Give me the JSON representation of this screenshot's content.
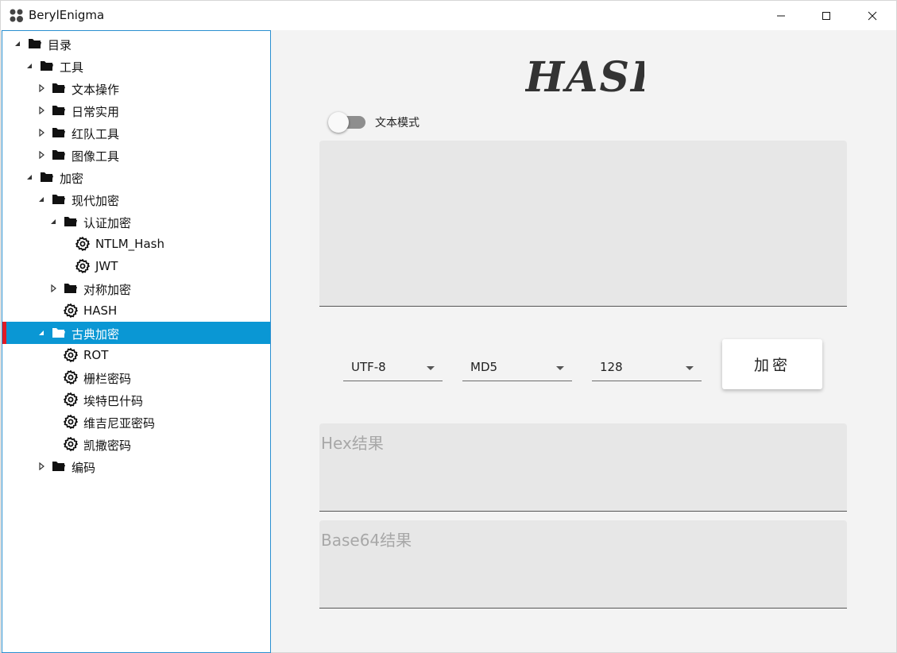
{
  "window": {
    "title": "BerylEnigma"
  },
  "tree": [
    {
      "label": "目录",
      "icon": "folder-icon",
      "arrow": "expanded",
      "level": 0
    },
    {
      "label": "工具",
      "icon": "folder-icon",
      "arrow": "expanded",
      "level": 1
    },
    {
      "label": "文本操作",
      "icon": "folder-icon",
      "arrow": "collapsed",
      "level": 2
    },
    {
      "label": "日常实用",
      "icon": "folder-icon",
      "arrow": "collapsed",
      "level": 2
    },
    {
      "label": "红队工具",
      "icon": "folder-icon",
      "arrow": "collapsed",
      "level": 2
    },
    {
      "label": "图像工具",
      "icon": "folder-icon",
      "arrow": "collapsed",
      "level": 2
    },
    {
      "label": "加密",
      "icon": "folder-icon",
      "arrow": "expanded",
      "level": 1
    },
    {
      "label": "现代加密",
      "icon": "folder-icon",
      "arrow": "expanded",
      "level": 2
    },
    {
      "label": "认证加密",
      "icon": "folder-icon",
      "arrow": "expanded",
      "level": 3
    },
    {
      "label": "NTLM_Hash",
      "icon": "gear-icon",
      "arrow": "none",
      "level": 4
    },
    {
      "label": "JWT",
      "icon": "gear-icon",
      "arrow": "none",
      "level": 4
    },
    {
      "label": "对称加密",
      "icon": "folder-icon",
      "arrow": "collapsed",
      "level": 3
    },
    {
      "label": "HASH",
      "icon": "gear-icon",
      "arrow": "none",
      "level": 3
    },
    {
      "label": "古典加密",
      "icon": "folder-icon",
      "arrow": "expanded",
      "level": 2,
      "selected": true
    },
    {
      "label": "ROT",
      "icon": "gear-icon",
      "arrow": "none",
      "level": 3
    },
    {
      "label": "栅栏密码",
      "icon": "gear-icon",
      "arrow": "none",
      "level": 3
    },
    {
      "label": "埃特巴什码",
      "icon": "gear-icon",
      "arrow": "none",
      "level": 3
    },
    {
      "label": "维吉尼亚密码",
      "icon": "gear-icon",
      "arrow": "none",
      "level": 3
    },
    {
      "label": "凯撒密码",
      "icon": "gear-icon",
      "arrow": "none",
      "level": 3
    },
    {
      "label": "编码",
      "icon": "folder-icon",
      "arrow": "collapsed",
      "level": 2
    }
  ],
  "main": {
    "title": "HASH",
    "text_mode_label": "文本模式",
    "text_mode_on": false,
    "input_value": "",
    "charset": {
      "value": "UTF-8"
    },
    "algorithm": {
      "value": "MD5"
    },
    "bits": {
      "value": "128"
    },
    "encrypt_label": "加密",
    "hex_placeholder": "Hex结果",
    "base64_placeholder": "Base64结果"
  },
  "colors": {
    "accent": "#0a97d4",
    "selected_marker": "#e01b24",
    "sidebar_border": "#2a8fd0"
  }
}
